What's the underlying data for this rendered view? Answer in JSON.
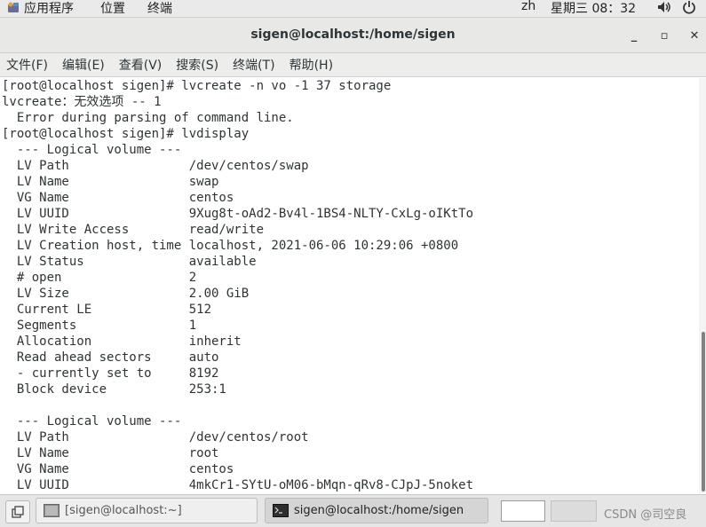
{
  "top_panel": {
    "applications": "应用程序",
    "places": "位置",
    "terminal": "终端",
    "input_method": "zh",
    "clock": "星期三 08：32",
    "icons": [
      "apps-icon",
      "volume-icon",
      "power-icon"
    ]
  },
  "window": {
    "title": "sigen@localhost:/home/sigen",
    "controls": {
      "minimize": "_",
      "maximize": "▫",
      "close": "✕"
    }
  },
  "menubar": {
    "items": [
      "文件(F)",
      "编辑(E)",
      "查看(V)",
      "搜索(S)",
      "终端(T)",
      "帮助(H)"
    ]
  },
  "terminal": {
    "lines": [
      "[root@localhost sigen]# lvcreate -n vo -1 37 storage",
      "lvcreate：无效选项 -- 1",
      "  Error during parsing of command line.",
      "[root@localhost sigen]# lvdisplay",
      "  --- Logical volume ---",
      "  LV Path                /dev/centos/swap",
      "  LV Name                swap",
      "  VG Name                centos",
      "  LV UUID                9Xug8t-oAd2-Bv4l-1BS4-NLTY-CxLg-oIKtTo",
      "  LV Write Access        read/write",
      "  LV Creation host, time localhost, 2021-06-06 10:29:06 +0800",
      "  LV Status              available",
      "  # open                 2",
      "  LV Size                2.00 GiB",
      "  Current LE             512",
      "  Segments               1",
      "  Allocation             inherit",
      "  Read ahead sectors     auto",
      "  - currently set to     8192",
      "  Block device           253:1",
      "",
      "  --- Logical volume ---",
      "  LV Path                /dev/centos/root",
      "  LV Name                root",
      "  VG Name                centos",
      "  LV UUID                4mkCr1-SYtU-oM06-bMqn-qRv8-CJpJ-5noket"
    ]
  },
  "taskbar": {
    "tasks": [
      {
        "label": "[sigen@localhost:~]",
        "active": false
      },
      {
        "label": "sigen@localhost:/home/sigen",
        "active": true
      }
    ],
    "watermark": "CSDN @司空良"
  },
  "colors": {
    "panel_bg": "#eaeaea",
    "titlebar_bg": "#e8e8e7",
    "terminal_bg": "#ffffff",
    "terminal_fg": "#2e3436"
  }
}
